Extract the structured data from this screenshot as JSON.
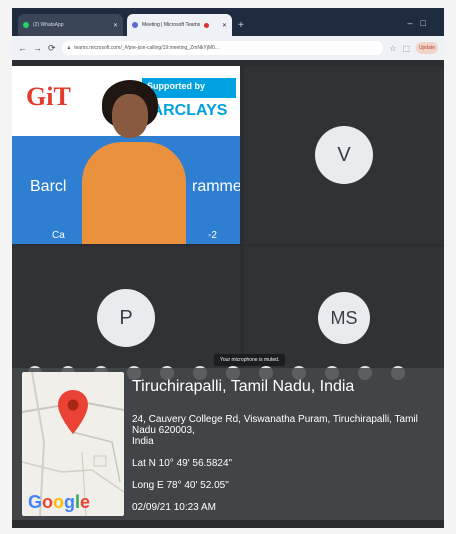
{
  "browser": {
    "tabs": [
      {
        "label": "(2) WhatsApp"
      },
      {
        "label": "Meeting | Microsoft Teams"
      }
    ],
    "url": "teams.microsoft.com/_#/pre-join-calling/19:meeting_ZmNkYjM0...",
    "profile_label": "Update"
  },
  "slide": {
    "logo": "GiT",
    "supported_by": "Supported by",
    "sponsor": "BARCLAYS",
    "banner_left": "Barcl",
    "banner_right": "ramme",
    "sub_left": "Ca",
    "sub_right": "-2"
  },
  "participants": {
    "tile_v": "V",
    "tile_p": "P",
    "tile_ms": "MS"
  },
  "toast": "Your microphone is muted.",
  "geotag": {
    "title": "Tiruchirapalli, Tamil Nadu, India",
    "address_line1": "24, Cauvery College Rd, Viswanatha Puram, Tiruchirapalli, Tamil Nadu 620003,",
    "address_line2": "India",
    "lat": "Lat N 10° 49' 56.5824\"",
    "long": "Long E 78° 40' 52.05\"",
    "datetime": "02/09/21 10:23 AM",
    "map_brand": "Google"
  },
  "colors": {
    "teams_bg": "#2b2d31",
    "tile_bg": "#303236",
    "barclays_blue": "#00a1e0",
    "pin_red": "#ea4335"
  }
}
